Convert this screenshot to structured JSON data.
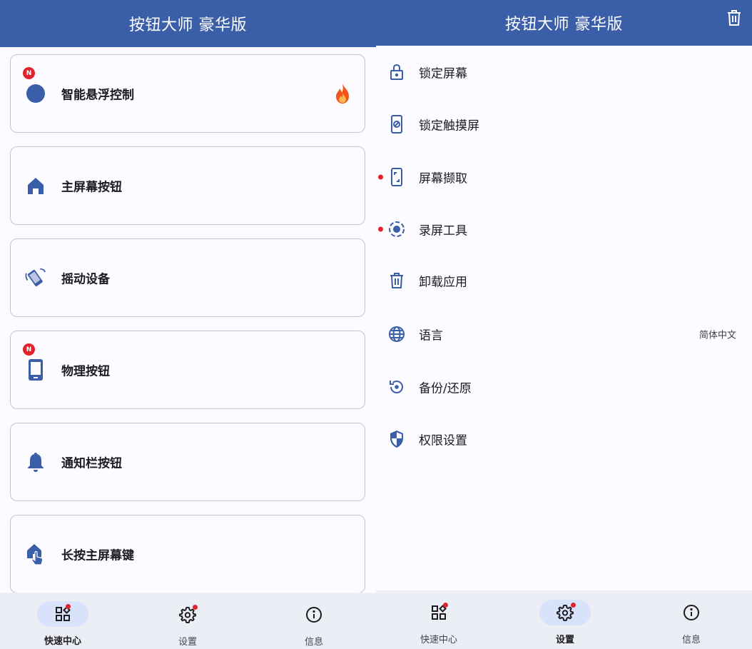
{
  "colors": {
    "primary": "#3a5ea8",
    "badge": "#e0232e",
    "nav_bg": "#eceef6",
    "active_pill": "#d9e2fb"
  },
  "left": {
    "title": "按钮大师 豪华版",
    "cards": [
      {
        "label": "智能悬浮控制",
        "icon": "circle-icon",
        "badge": "N",
        "trailing_icon": "fire-icon"
      },
      {
        "label": "主屏幕按钮",
        "icon": "home-icon"
      },
      {
        "label": "摇动设备",
        "icon": "shake-icon"
      },
      {
        "label": "物理按钮",
        "icon": "phone-icon",
        "badge": "N"
      },
      {
        "label": "通知栏按钮",
        "icon": "bell-icon"
      },
      {
        "label": "长按主屏幕键",
        "icon": "home-touch-icon"
      }
    ],
    "nav": [
      {
        "label": "快速中心",
        "icon": "dashboard-icon",
        "active": true,
        "dot": true
      },
      {
        "label": "设置",
        "icon": "gear-icon",
        "active": false,
        "dot": true
      },
      {
        "label": "信息",
        "icon": "info-icon",
        "active": false,
        "dot": false
      }
    ]
  },
  "right": {
    "title": "按钮大师 豪华版",
    "action_icon": "trash-icon",
    "items": [
      {
        "label": "锁定屏幕",
        "icon": "lock-icon"
      },
      {
        "label": "锁定触摸屏",
        "icon": "phone-lock-icon"
      },
      {
        "label": "屏幕撷取",
        "icon": "screenshot-icon",
        "dot": true
      },
      {
        "label": "录屏工具",
        "icon": "record-icon",
        "dot": true
      },
      {
        "label": "卸载应用",
        "icon": "trash-icon"
      },
      {
        "label": "语言",
        "icon": "globe-icon",
        "value": "简体中文"
      },
      {
        "label": "备份/还原",
        "icon": "restore-icon"
      },
      {
        "label": "权限设置",
        "icon": "shield-icon"
      }
    ],
    "nav": [
      {
        "label": "快速中心",
        "icon": "dashboard-icon",
        "active": false,
        "dot": true
      },
      {
        "label": "设置",
        "icon": "gear-icon",
        "active": true,
        "dot": true
      },
      {
        "label": "信息",
        "icon": "info-icon",
        "active": false,
        "dot": false
      }
    ]
  }
}
